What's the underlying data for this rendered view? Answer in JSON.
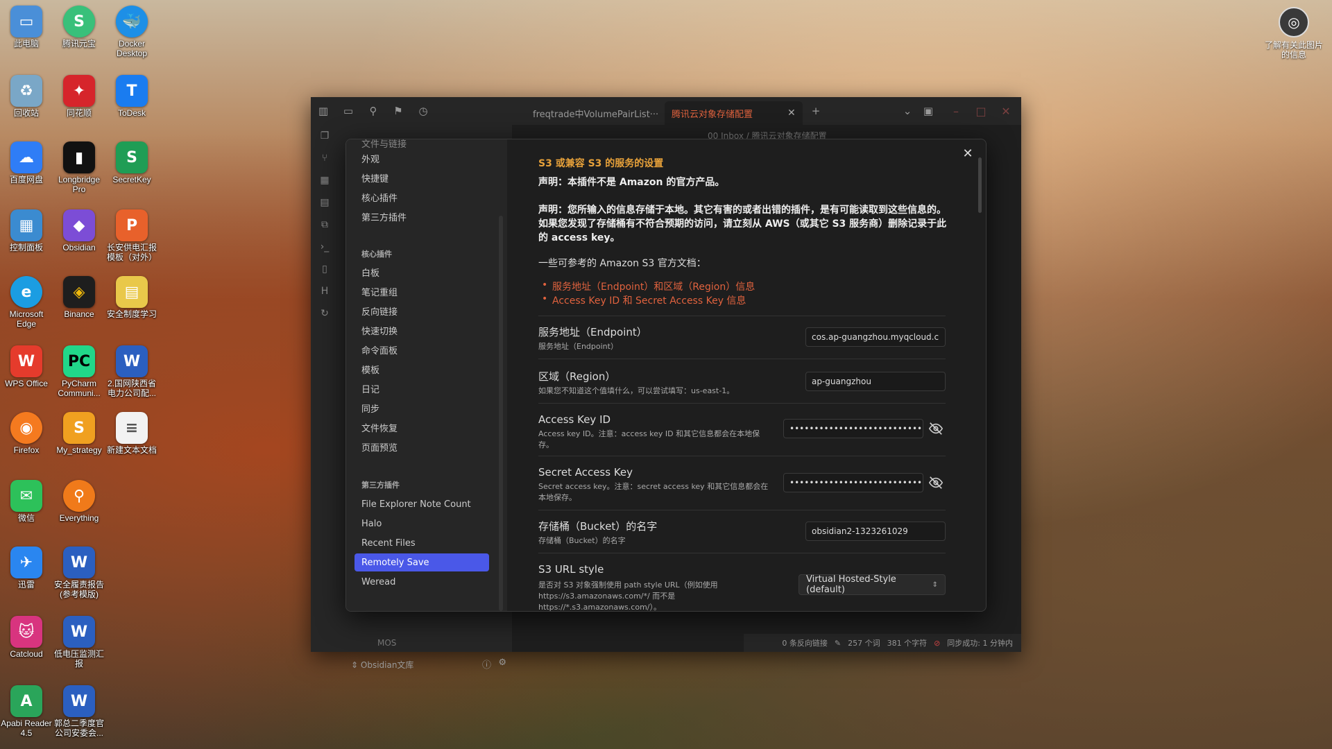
{
  "desktop": {
    "col1": [
      "此电脑",
      "回收站",
      "百度网盘",
      "控制面板",
      "Microsoft Edge",
      "WPS Office",
      "Firefox",
      "微信",
      "迅雷",
      "Catcloud",
      "Apabi Reader 4.5"
    ],
    "col2": [
      "腾讯元宝",
      "同花顺",
      "Longbridge Pro",
      "Obsidian",
      "Binance",
      "PyCharm Communi...",
      "My_strategy",
      "Everything",
      "安全履责报告(参考模版)",
      "低电压监测汇报",
      "郭总二季度官公司安委会..."
    ],
    "col3": [
      "Docker Desktop",
      "ToDesk",
      "SecretKey",
      "长安供电汇报模板（对外）",
      "安全制度学习",
      "2.国网陕西省电力公司配...",
      "新建文本文档"
    ],
    "topright": "了解有关此图片的信息"
  },
  "window": {
    "tabs": [
      "freqtrade中VolumePairList···",
      "腾讯云对象存储配置"
    ],
    "breadcrumb": "00 Inbox / 腾讯云对象存储配置",
    "nav_mos": "MOS",
    "vault_name": "Obsidian文库",
    "status": {
      "backlinks": "0 条反向链接",
      "words": "257 个词",
      "chars": "381 个字符",
      "sync": "同步成功: 1 分钟内"
    }
  },
  "settings": {
    "sidebar": {
      "top_partial": "文件与链接",
      "options": [
        "外观",
        "快捷键",
        "核心插件",
        "第三方插件"
      ],
      "core_heading": "核心插件",
      "core": [
        "白板",
        "笔记重组",
        "反向链接",
        "快速切换",
        "命令面板",
        "模板",
        "日记",
        "同步",
        "文件恢复",
        "页面预览"
      ],
      "community_heading": "第三方插件",
      "community": [
        "File Explorer Note Count",
        "Halo",
        "Recent Files",
        "Remotely Save",
        "Weread"
      ],
      "active": "Remotely Save"
    },
    "heading": "S3 或兼容 S3 的服务的设置",
    "disclaimer1": "声明：本插件不是 Amazon 的官方产品。",
    "disclaimer2": "声明：您所输入的信息存储于本地。其它有害的或者出错的插件，是有可能读取到这些信息的。如果您发现了存储桶有不符合预期的访问，请立刻从 AWS（或其它 S3 服务商）删除记录于此的 access key。",
    "docs_intro": "一些可参考的 Amazon S3 官方文档：",
    "doc_links": [
      "服务地址（Endpoint）和区域（Region）信息",
      "Access Key ID 和 Secret Access Key 信息"
    ],
    "fields": {
      "endpoint": {
        "name": "服务地址（Endpoint）",
        "desc": "服务地址（Endpoint）",
        "value": "cos.ap-guangzhou.myqcloud.c"
      },
      "region": {
        "name": "区域（Region）",
        "desc": "如果您不知道这个值填什么，可以尝试填写：us-east-1。",
        "value": "ap-guangzhou"
      },
      "access_key": {
        "name": "Access Key ID",
        "desc": "Access key ID。注意：access key ID 和其它信息都会在本地保存。",
        "value": "••••••••••••••••••••••••••••••••••••"
      },
      "secret_key": {
        "name": "Secret Access Key",
        "desc": "Secret access key。注意：secret access key 和其它信息都会在本地保存。",
        "value": "••••••••••••••••••••••••••••••••"
      },
      "bucket": {
        "name": "存储桶（Bucket）的名字",
        "desc": "存储桶（Bucket）的名字",
        "value": "obsidian2-1323261029"
      },
      "url_style": {
        "name": "S3 URL style",
        "desc": "是否对 S3 对象强制使用 path style URL（例如使用 https://s3.amazonaws.com/*/ 而不是 https://*.s3.amazonaws.com/）。",
        "value": "Virtual Hosted-Style (default)"
      }
    }
  },
  "colors": {
    "accent": "#4a58e8",
    "heading": "#e8a23a",
    "link": "#e0623e"
  }
}
